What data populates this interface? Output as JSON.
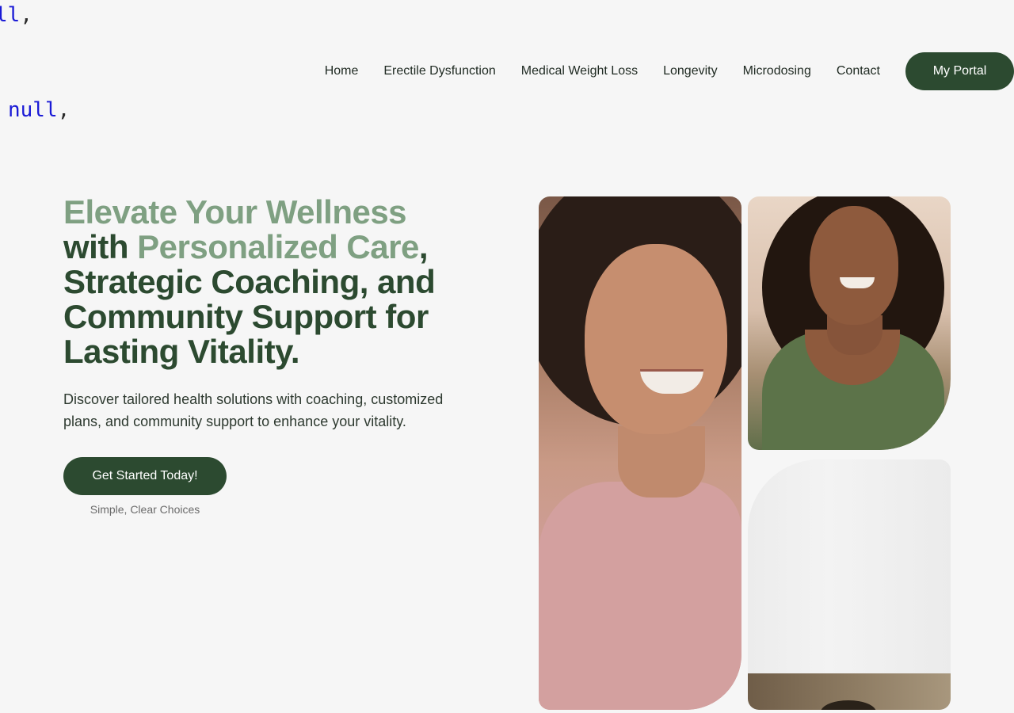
{
  "debug_overlay": {
    "top_text": "ll",
    "mid_text": "null",
    "separator": ","
  },
  "nav": {
    "items": [
      {
        "label": "Home"
      },
      {
        "label": "Erectile Dysfunction"
      },
      {
        "label": "Medical Weight Loss"
      },
      {
        "label": "Longevity"
      },
      {
        "label": "Microdosing"
      },
      {
        "label": "Contact"
      }
    ],
    "portal_button": "My Portal"
  },
  "hero": {
    "headline": {
      "part1": "Elevate Your Wellness",
      "part2": "with",
      "part3": "Personalized Care",
      "part4": ",",
      "part5": "Strategic Coaching, and Community Support for Lasting Vitality."
    },
    "subtext": "Discover tailored health solutions with coaching, customized plans, and community support to enhance your vitality.",
    "cta_label": "Get Started Today!",
    "cta_caption": "Simple, Clear Choices"
  },
  "colors": {
    "background": "#f6f6f6",
    "primary_dark_green": "#2c4a30",
    "accent_sage_green": "#7fa082",
    "debug_text_blue": "#1a1ad6"
  }
}
